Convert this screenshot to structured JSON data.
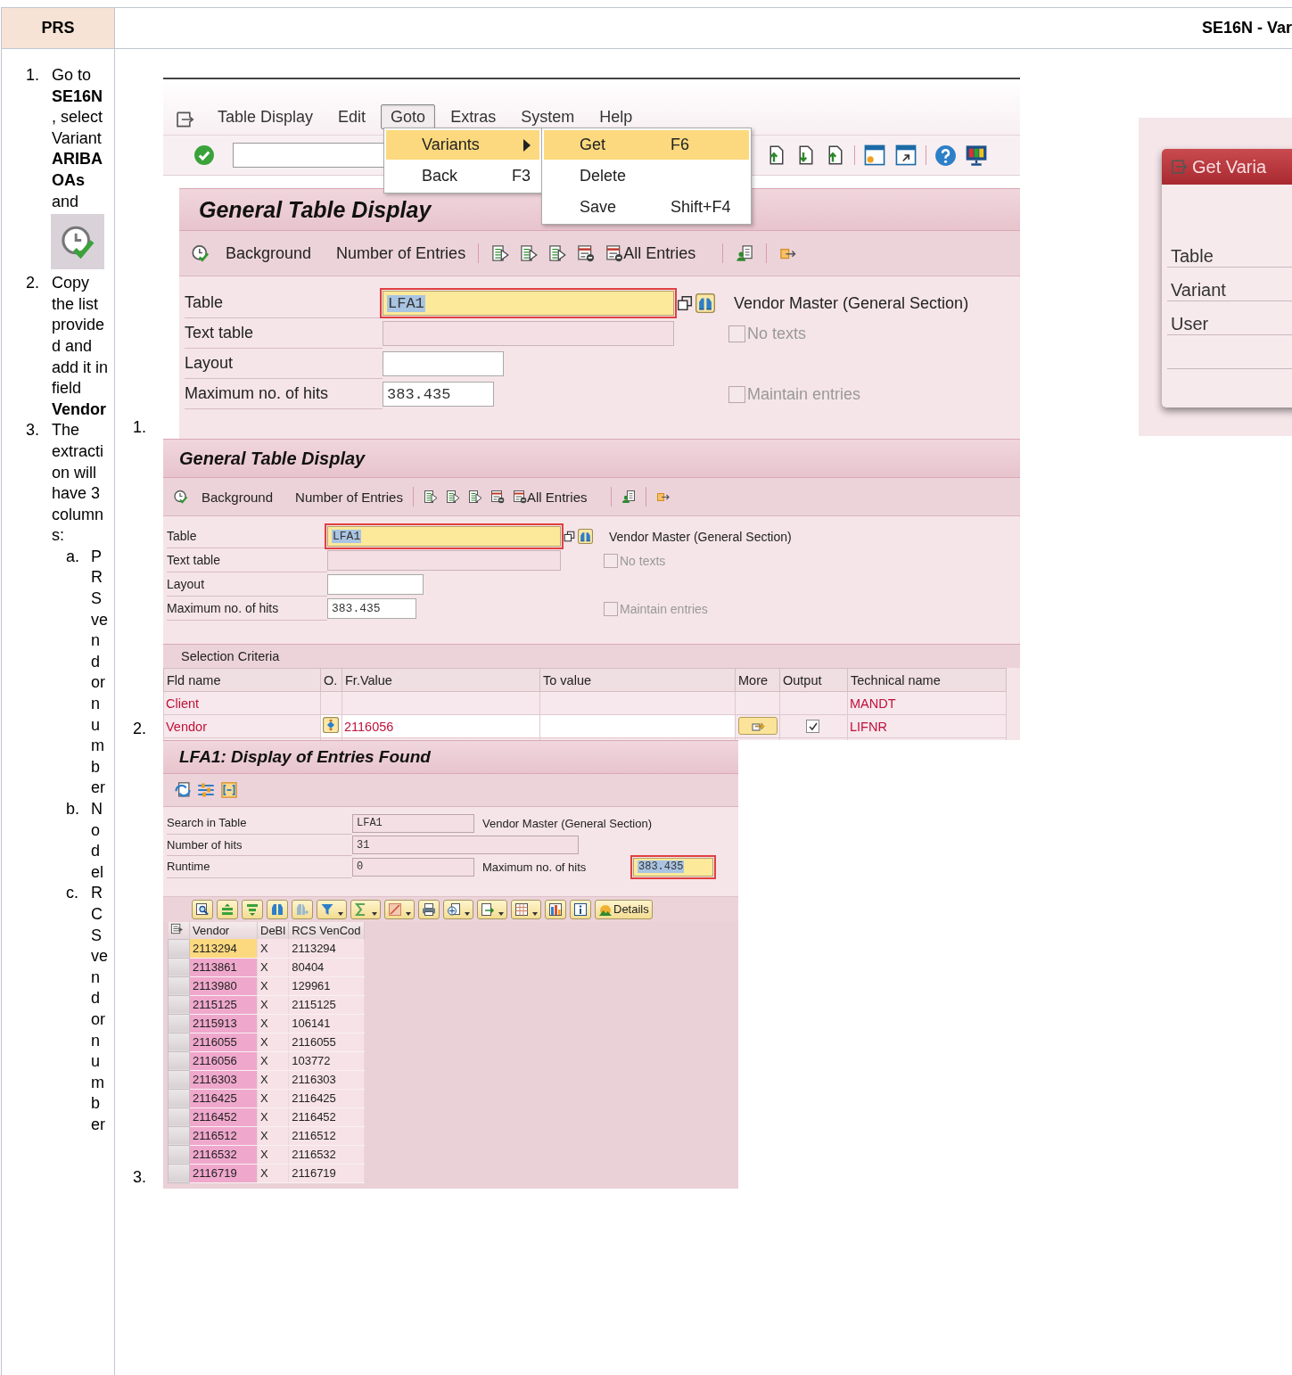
{
  "header": {
    "title": "PRS",
    "column_2": "SE16N - Var"
  },
  "steps": [
    {
      "number": "1.",
      "kind": "icon",
      "text": "Go to **SE16N** , select Variant **ARIBA OAs** and"
    },
    {
      "number": "2.",
      "kind": "text",
      "text": "Copy the list provided and add it in field **Vendor**"
    },
    {
      "number": "3.",
      "kind": "list",
      "text": "The extraction will have 3 columns:",
      "substeps": [
        {
          "number": "a.",
          "text": "PRS vendor number"
        },
        {
          "number": "b.",
          "text": "Nodel"
        },
        {
          "number": "c.",
          "text": "RCS vendor number"
        }
      ]
    }
  ],
  "goto_screenshot": {
    "number": "1.",
    "menubar": [
      {
        "label": "Table Display",
        "selected": false
      },
      {
        "label": "Edit",
        "selected": false
      },
      {
        "label": "Goto",
        "selected": true
      },
      {
        "label": "Extras",
        "selected": false
      },
      {
        "label": "System",
        "selected": false
      },
      {
        "label": "Help",
        "selected": false
      }
    ],
    "goto_menu": [
      {
        "label": "Variants",
        "kind": "submenu",
        "selected": true
      },
      {
        "label": "Back",
        "kind": "command",
        "shortcut": "F3",
        "selected": false
      }
    ],
    "variants_menu": [
      {
        "label": "Get",
        "shortcut": "F6",
        "selected": true
      },
      {
        "label": "Delete",
        "selected": false
      },
      {
        "label": "Save",
        "shortcut": "Shift+F4",
        "selected": false
      }
    ],
    "title": "General Table Display",
    "toolbar": {
      "background": "Background",
      "number_of_entries": "Number of Entries",
      "all_entries": "All Entries"
    },
    "form": {
      "table_label": "Table",
      "table_value": "LFA1",
      "description": "Vendor Master (General Section)",
      "text_table_label": "Text table",
      "no_texts": {
        "label": "No texts",
        "checked": false
      },
      "layout_label": "Layout",
      "max_hits_label": "Maximum no. of hits",
      "max_hits": "383.435",
      "maintain_entries": {
        "label": "Maintain entries",
        "checked": false
      }
    }
  },
  "selection_screenshot": {
    "number": "2.",
    "title": "General Table Display",
    "toolbar": {
      "background": "Background",
      "number_of_entries": "Number of Entries",
      "all_entries": "All Entries"
    },
    "form": {
      "table_label": "Table",
      "table_value": "LFA1",
      "description": "Vendor Master (General Section)",
      "text_table_label": "Text table",
      "no_texts": {
        "label": "No texts",
        "checked": false
      },
      "layout_label": "Layout",
      "max_hits_label": "Maximum no. of hits",
      "max_hits": "383.435",
      "maintain_entries": {
        "label": "Maintain entries",
        "checked": false
      }
    },
    "criteria": {
      "title": "Selection Criteria",
      "columns": [
        "Fld name",
        "O.",
        "Fr.Value",
        "To value",
        "More",
        "Output",
        "Technical name"
      ],
      "rows": [
        {
          "kind": "fixed",
          "field": "Client",
          "technical_name": "MANDT"
        },
        {
          "kind": "editable",
          "field": "Vendor",
          "from_value": "2116056",
          "output": true,
          "technical_name": "LIFNR"
        }
      ]
    }
  },
  "results_screenshot": {
    "number": "3.",
    "title": "LFA1: Display of Entries Found",
    "form": {
      "search_label": "Search in Table",
      "search_value": "LFA1",
      "description": "Vendor Master (General Section)",
      "hits_label": "Number of hits",
      "hits_value": "31",
      "runtime_label": "Runtime",
      "runtime_value": "0",
      "max_hits_label": "Maximum no. of hits",
      "max_hits_value": "383.435"
    },
    "details_button": "Details",
    "grid": {
      "columns": [
        "Vendor",
        "DeBl",
        "RCS VenCod"
      ],
      "rows": [
        {
          "cells": [
            "2113294",
            "X",
            "2113294"
          ],
          "selected": true
        },
        {
          "cells": [
            "2113861",
            "X",
            "80404"
          ],
          "selected": false
        },
        {
          "cells": [
            "2113980",
            "X",
            "129961"
          ],
          "selected": false
        },
        {
          "cells": [
            "2115125",
            "X",
            "2115125"
          ],
          "selected": false
        },
        {
          "cells": [
            "2115913",
            "X",
            "106141"
          ],
          "selected": false
        },
        {
          "cells": [
            "2116055",
            "X",
            "2116055"
          ],
          "selected": false
        },
        {
          "cells": [
            "2116056",
            "X",
            "103772"
          ],
          "selected": false
        },
        {
          "cells": [
            "2116303",
            "X",
            "2116303"
          ],
          "selected": false
        },
        {
          "cells": [
            "2116425",
            "X",
            "2116425"
          ],
          "selected": false
        },
        {
          "cells": [
            "2116452",
            "X",
            "2116452"
          ],
          "selected": false
        },
        {
          "cells": [
            "2116512",
            "X",
            "2116512"
          ],
          "selected": false
        },
        {
          "cells": [
            "2116532",
            "X",
            "2116532"
          ],
          "selected": false
        },
        {
          "cells": [
            "2116719",
            "X",
            "2116719"
          ],
          "selected": false
        }
      ]
    }
  },
  "get_variant_dialog": {
    "title": "Get Varia",
    "fields": [
      "Table",
      "Variant",
      "User"
    ]
  }
}
